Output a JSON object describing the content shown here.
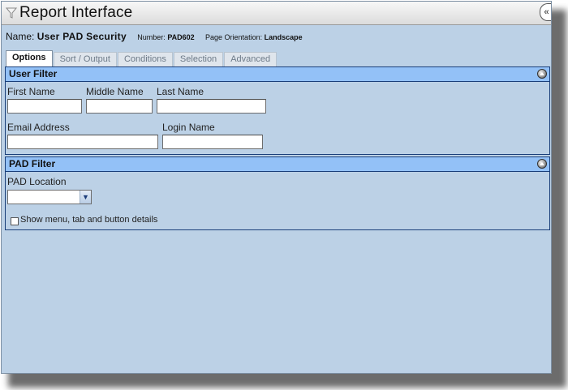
{
  "window": {
    "title": "Report Interface",
    "collapse_glyph": "«"
  },
  "report": {
    "name_label": "Name:",
    "name_value": "User PAD Security",
    "number_label": "Number:",
    "number_value": "PAD602",
    "orientation_label": "Page Orientation:",
    "orientation_value": "Landscape"
  },
  "tabs": [
    {
      "label": "Options",
      "active": true
    },
    {
      "label": "Sort / Output",
      "active": false
    },
    {
      "label": "Conditions",
      "active": false
    },
    {
      "label": "Selection",
      "active": false
    },
    {
      "label": "Advanced",
      "active": false
    }
  ],
  "user_filter": {
    "title": "User Filter",
    "first_name": {
      "label": "First Name",
      "value": ""
    },
    "middle_name": {
      "label": "Middle Name",
      "value": ""
    },
    "last_name": {
      "label": "Last Name",
      "value": ""
    },
    "email": {
      "label": "Email Address",
      "value": ""
    },
    "login": {
      "label": "Login Name",
      "value": ""
    }
  },
  "pad_filter": {
    "title": "PAD Filter",
    "location": {
      "label": "PAD Location",
      "selected": ""
    },
    "show_details": {
      "label": "Show menu, tab and button details",
      "checked": false
    }
  },
  "colors": {
    "window_bg": "#bcd1e6",
    "panel_header": "#93c1f7",
    "panel_border": "#1a3f7a"
  },
  "icons": {
    "title": "filter-funnel-icon",
    "collapse": "double-chevron-left-icon",
    "panel_toggle": "collapse-circle-icon",
    "select": "chevron-down-icon"
  }
}
